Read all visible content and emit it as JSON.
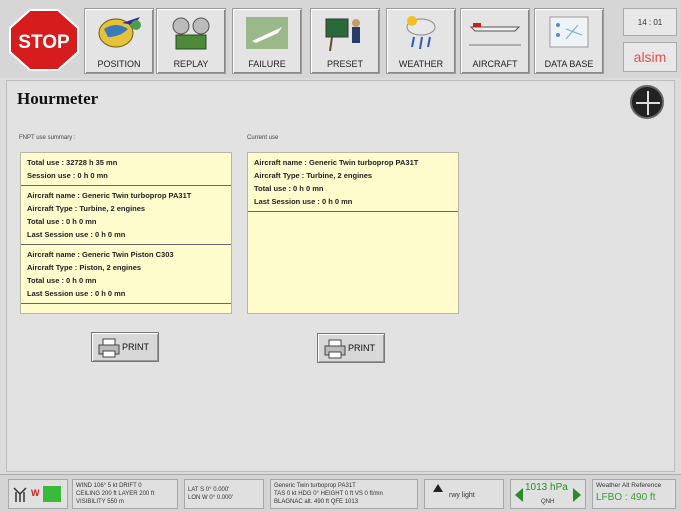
{
  "toolbar": {
    "stop_label": "STOP",
    "buttons": [
      {
        "label": "POSITION",
        "icon": "globe-plane-icon"
      },
      {
        "label": "REPLAY",
        "icon": "film-reel-icon"
      },
      {
        "label": "FAILURE",
        "icon": "crashed-plane-icon"
      },
      {
        "label": "PRESET",
        "icon": "instructor-board-icon"
      },
      {
        "label": "WEATHER",
        "icon": "cloud-rain-icon"
      },
      {
        "label": "AIRCRAFT",
        "icon": "aircraft-icon"
      },
      {
        "label": "DATA BASE",
        "icon": "database-map-icon"
      }
    ],
    "clock": "14 : 01",
    "brand": "alsim"
  },
  "page": {
    "title": "Hourmeter"
  },
  "summary": {
    "label": "FNPT use summary :",
    "groups": [
      [
        "Total use : 32728 h 35 mn",
        "Session use : 0 h 0 mn"
      ],
      [
        "Aircraft name : Generic Twin turboprop PA31T",
        "Aircraft Type : Turbine, 2 engines",
        "Total use : 0 h 0 mn",
        "Last Session use : 0 h 0 mn"
      ],
      [
        "Aircraft name : Generic Twin Piston C303",
        "Aircraft Type : Piston, 2 engines",
        "Total use : 0 h 0 mn",
        "Last Session use : 0 h 0 mn"
      ]
    ],
    "print_label": "PRINT"
  },
  "current": {
    "label": "Current use",
    "groups": [
      [
        "Aircraft name : Generic Twin turboprop PA31T",
        "Aircraft Type : Turbine, 2 engines",
        "Total use : 0 h 0 mn",
        "Last Session use : 0 h 0 mn"
      ]
    ],
    "print_label": "PRINT"
  },
  "status": {
    "weather": [
      "WIND 106° 5 kt DRIFT 0",
      "CEILING 200 ft LAYER 200 ft",
      "VISIBILITY 550 m"
    ],
    "position": [
      "LAT S 0° 0.000'",
      "LON W 0° 0.000'"
    ],
    "aircraft": [
      "Generic Twin turboprop PA31T",
      "TAS 0 kt HDG 0° HEIGHT 0 ft VS 0 ft/mn",
      "BLAGNAC alt. 490 ft QFE 1013"
    ],
    "rwy_light": "rwy light",
    "qnh_value": "1013 hPa",
    "qnh_label": "QNH",
    "ref_label": "Weather Alt Reference",
    "ref_value": "LFBO : 490 ft",
    "w_label": "W"
  }
}
